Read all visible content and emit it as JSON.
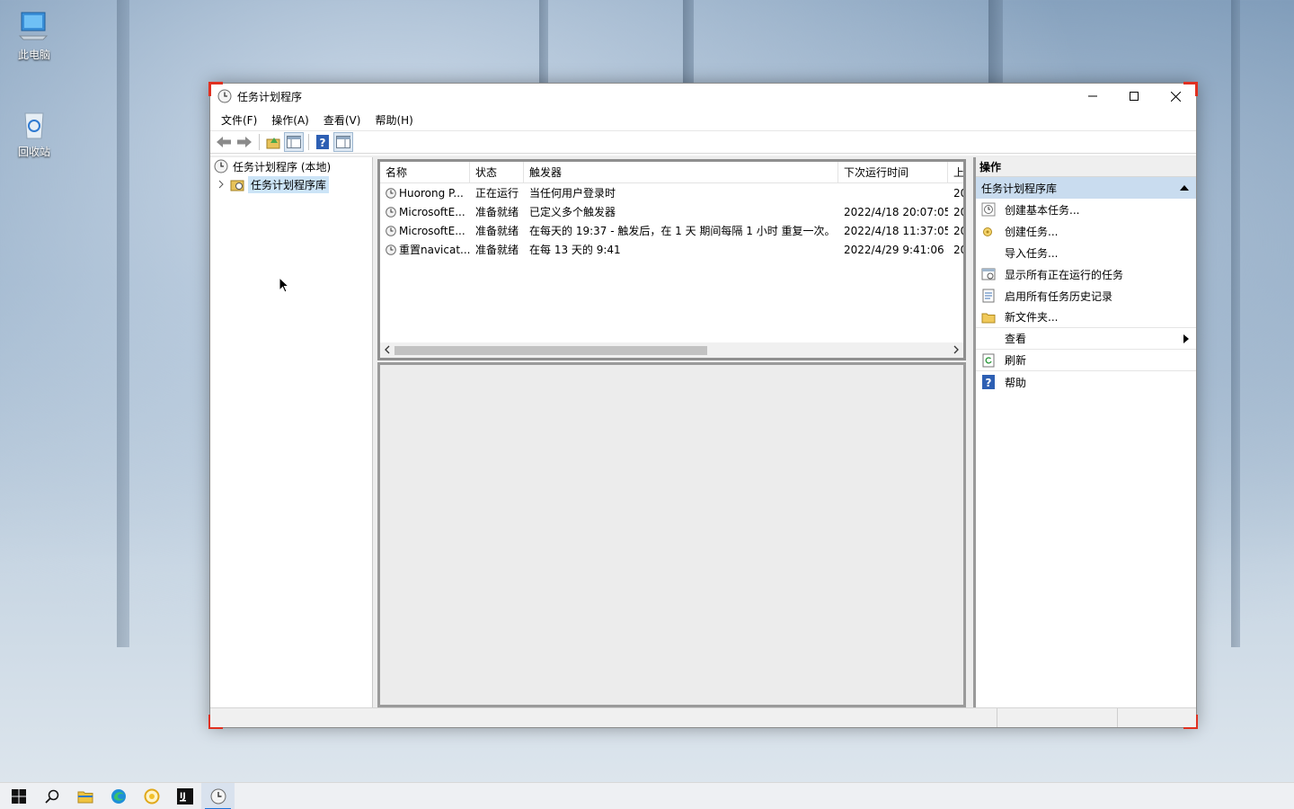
{
  "desktop": {
    "icons": [
      {
        "label": "此电脑"
      },
      {
        "label": "回收站"
      }
    ]
  },
  "window": {
    "title": "任务计划程序",
    "menu": [
      "文件(F)",
      "操作(A)",
      "查看(V)",
      "帮助(H)"
    ],
    "tree": {
      "root": "任务计划程序 (本地)",
      "library": "任务计划程序库"
    },
    "list": {
      "columns": [
        "名称",
        "状态",
        "触发器",
        "下次运行时间",
        "上"
      ],
      "rows": [
        {
          "name": "Huorong P...",
          "status": "正在运行",
          "trigger": "当任何用户登录时",
          "next_run": "",
          "last": "20"
        },
        {
          "name": "MicrosoftE...",
          "status": "准备就绪",
          "trigger": "已定义多个触发器",
          "next_run": "2022/4/18 20:07:05",
          "last": "20"
        },
        {
          "name": "MicrosoftE...",
          "status": "准备就绪",
          "trigger": "在每天的 19:37 - 触发后，在 1 天 期间每隔 1 小时 重复一次。",
          "next_run": "2022/4/18 11:37:05",
          "last": "20"
        },
        {
          "name": "重置navicat...",
          "status": "准备就绪",
          "trigger": "在每 13 天的 9:41",
          "next_run": "2022/4/29 9:41:06",
          "last": "20"
        }
      ]
    },
    "actions": {
      "header": "操作",
      "section": "任务计划程序库",
      "items": [
        {
          "label": "创建基本任务...",
          "icon": "basic-task-icon"
        },
        {
          "label": "创建任务...",
          "icon": "create-task-icon"
        },
        {
          "label": "导入任务...",
          "icon": ""
        },
        {
          "label": "显示所有正在运行的任务",
          "icon": "running-tasks-icon"
        },
        {
          "label": "启用所有任务历史记录",
          "icon": "history-icon"
        },
        {
          "label": "新文件夹...",
          "icon": "folder-icon"
        },
        {
          "label": "查看",
          "icon": ""
        },
        {
          "label": "刷新",
          "icon": "refresh-icon"
        },
        {
          "label": "帮助",
          "icon": "help-icon"
        }
      ]
    }
  },
  "colors": {
    "selection": "#cce4f7",
    "action_section": "#c9dcef",
    "accent": "#1a73d9",
    "window_corner": "#e03020"
  }
}
